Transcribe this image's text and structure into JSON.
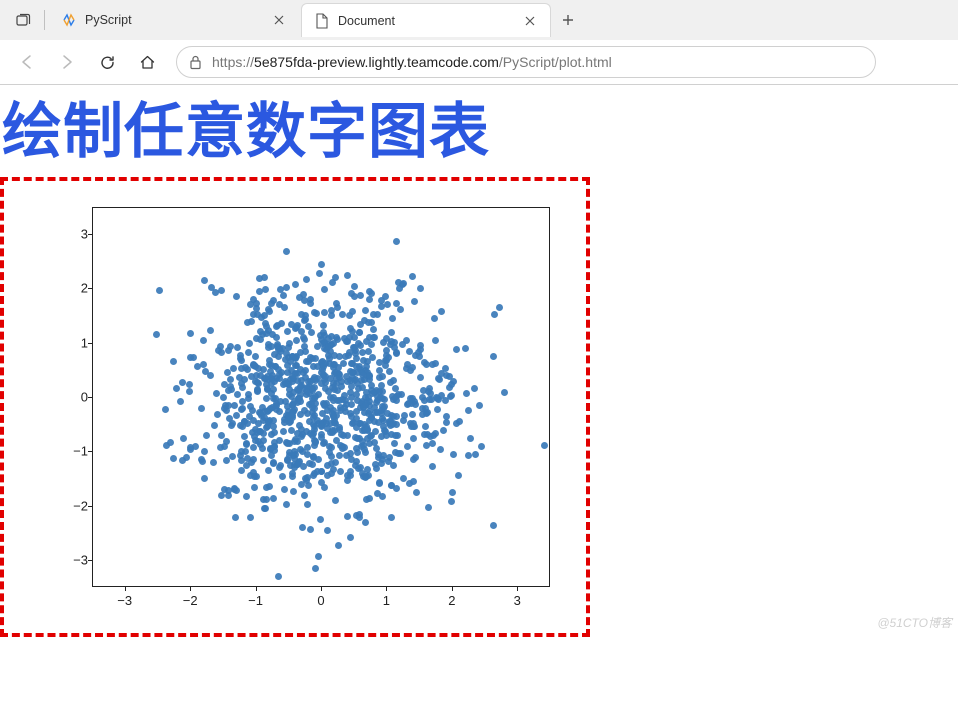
{
  "browser": {
    "tabs": [
      {
        "title": "PyScript",
        "favicon": "pyscript",
        "active": false
      },
      {
        "title": "Document",
        "favicon": "doc",
        "active": true
      }
    ],
    "url_prefix": "https://",
    "url_host": "5e875fda-preview.lightly.teamcode.com",
    "url_path": "/PyScript/plot.html"
  },
  "page": {
    "title": "绘制任意数字图表",
    "watermark": "@51CTO博客"
  },
  "chart_data": {
    "type": "scatter",
    "title": "",
    "xlabel": "",
    "ylabel": "",
    "xlim": [
      -3.5,
      3.5
    ],
    "ylim": [
      -3.5,
      3.5
    ],
    "xticks": [
      -3,
      -2,
      -1,
      0,
      1,
      2,
      3
    ],
    "yticks": [
      -3,
      -2,
      -1,
      0,
      1,
      2,
      3
    ],
    "n_points": 1000,
    "distribution": "standard_normal_2d",
    "seed": 42,
    "color_hex": "#3a7ab8"
  }
}
